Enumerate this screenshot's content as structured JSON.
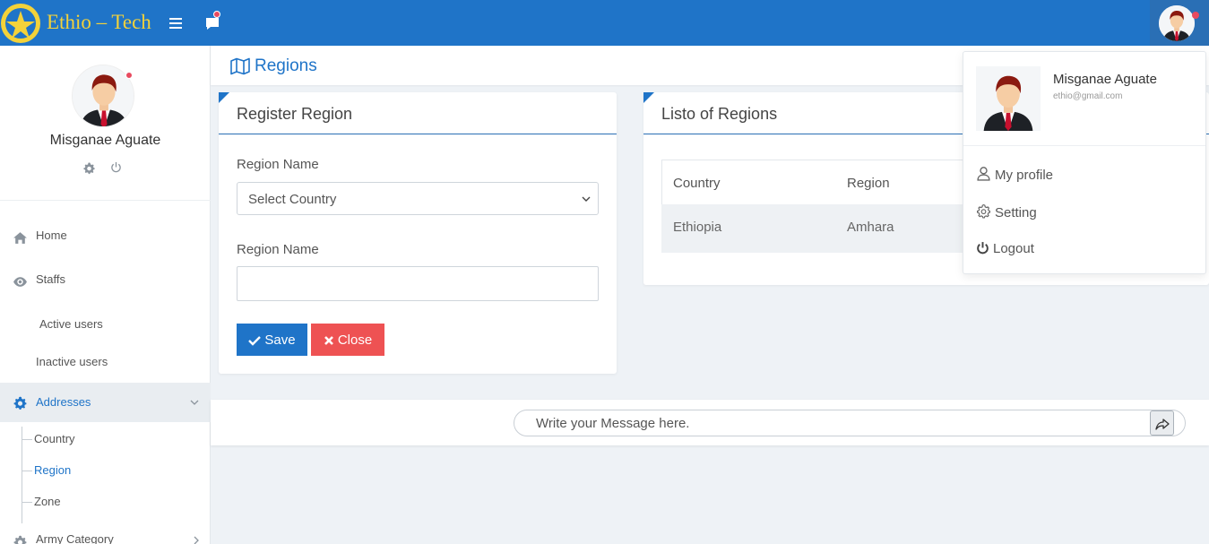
{
  "brand": {
    "name": "Ethio – Tech"
  },
  "colors": {
    "primary": "#1f74c8",
    "danger": "#ee5253",
    "badge": "#e84a5f",
    "brand_text": "#f3d23a"
  },
  "topbar": {
    "menu_icon": "hamburger-icon",
    "chat_icon": "chat-icon"
  },
  "sidebar": {
    "user_name": "Misganae Aguate",
    "items": [
      {
        "label": "Home",
        "icon": "home-icon"
      },
      {
        "label": "Staffs",
        "icon": "eye-icon"
      },
      {
        "label": "Active users"
      },
      {
        "label": "Inactive users"
      },
      {
        "label": "Addresses",
        "icon": "gear-icon"
      },
      {
        "label": "Army Category",
        "icon": "gear-icon"
      }
    ],
    "subitems": [
      {
        "label": "Country"
      },
      {
        "label": "Region",
        "active": true
      },
      {
        "label": "Zone"
      }
    ]
  },
  "page": {
    "title": "Regions",
    "icon": "map-icon"
  },
  "register_card": {
    "title": "Register Region",
    "country_label": "Region Name",
    "country_select_value": "Select Country",
    "region_label": "Region Name",
    "region_value": "",
    "save_label": "Save",
    "close_label": "Close"
  },
  "list_card": {
    "title": "Listo of Regions",
    "columns": [
      "Country",
      "Region"
    ],
    "rows": [
      [
        "Ethiopia",
        "Amhara"
      ]
    ]
  },
  "chat": {
    "placeholder": "Write your Message here."
  },
  "dropdown": {
    "name": "Misganae Aguate",
    "email": "ethio@gmail.com",
    "items": [
      {
        "label": "My profile",
        "icon": "user-icon"
      },
      {
        "label": "Setting",
        "icon": "gear-icon"
      },
      {
        "label": "Logout",
        "icon": "power-icon"
      }
    ]
  }
}
